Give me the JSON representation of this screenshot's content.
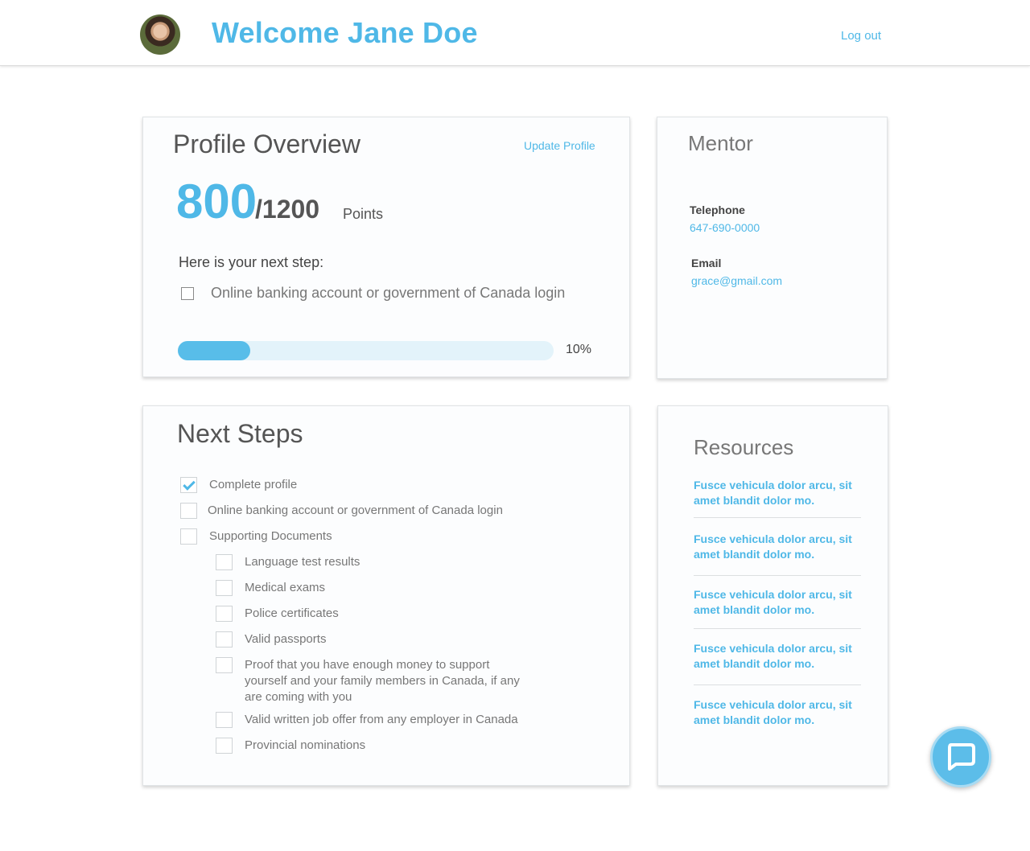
{
  "header": {
    "welcome": "Welcome Jane Doe",
    "logout_label": "Log out"
  },
  "profile": {
    "title": "Profile Overview",
    "update_label": "Update Profile",
    "points": "800",
    "points_total": "/1200",
    "points_label": "Points",
    "next_step_heading": "Here is your next step:",
    "next_step_item": "Online banking account or government of Canada login",
    "progress_percent": 10,
    "progress_label": "10%"
  },
  "mentor": {
    "title": "Mentor",
    "telephone_label": "Telephone",
    "telephone": "647-690-0000",
    "email_label": "Email",
    "email": "grace@gmail.com"
  },
  "next_steps": {
    "title": "Next Steps",
    "items": [
      {
        "label": "Complete profile",
        "checked": true
      },
      {
        "label": "Online banking account or government of Canada login",
        "checked": false
      },
      {
        "label": "Supporting Documents",
        "checked": false
      },
      {
        "label": "Language test results",
        "checked": false
      },
      {
        "label": "Medical exams",
        "checked": false
      },
      {
        "label": "Police certificates",
        "checked": false
      },
      {
        "label": "Valid passports",
        "checked": false
      },
      {
        "label": "Proof that you have enough money to support yourself and your family members in Canada, if any are coming with you",
        "checked": false
      },
      {
        "label": "Valid written job offer from any employer in Canada",
        "checked": false
      },
      {
        "label": "Provincial nominations",
        "checked": false
      }
    ]
  },
  "resources": {
    "title": "Resources",
    "links": [
      "Fusce vehicula dolor arcu, sit amet blandit dolor mo.",
      "Fusce vehicula dolor arcu, sit amet blandit dolor mo.",
      "Fusce vehicula dolor arcu, sit amet blandit dolor mo.",
      "Fusce vehicula dolor arcu, sit amet blandit dolor mo.",
      "Fusce vehicula dolor arcu, sit amet blandit dolor mo."
    ]
  },
  "icons": {
    "avatar": "user-avatar",
    "chat": "chat-bubble-icon"
  },
  "colors": {
    "accent": "#4fb8e7",
    "progress_track": "#e3f3fa",
    "text": "#5a5a5a"
  }
}
